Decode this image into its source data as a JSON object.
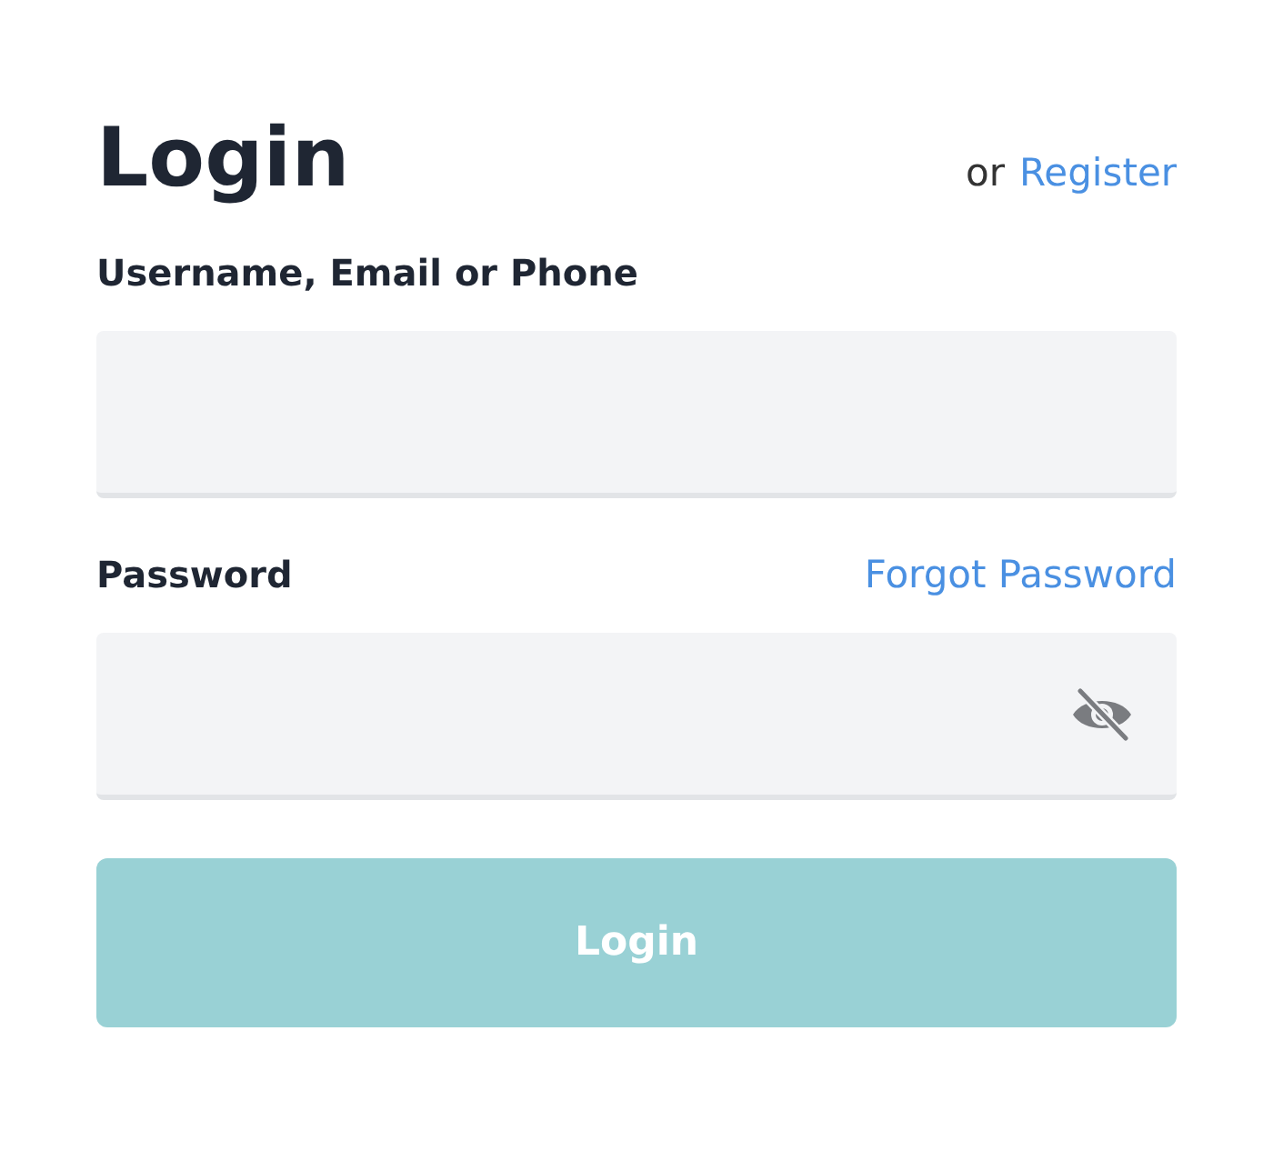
{
  "title": "Login",
  "register_prompt": {
    "prefix": "or",
    "link": "Register"
  },
  "fields": [
    {
      "kind": "text",
      "label": "Username, Email or Phone"
    },
    {
      "kind": "password",
      "label": "Password",
      "link": "Forgot Password",
      "visible": false
    }
  ],
  "submit": {
    "label": "Login",
    "disabled": true
  }
}
